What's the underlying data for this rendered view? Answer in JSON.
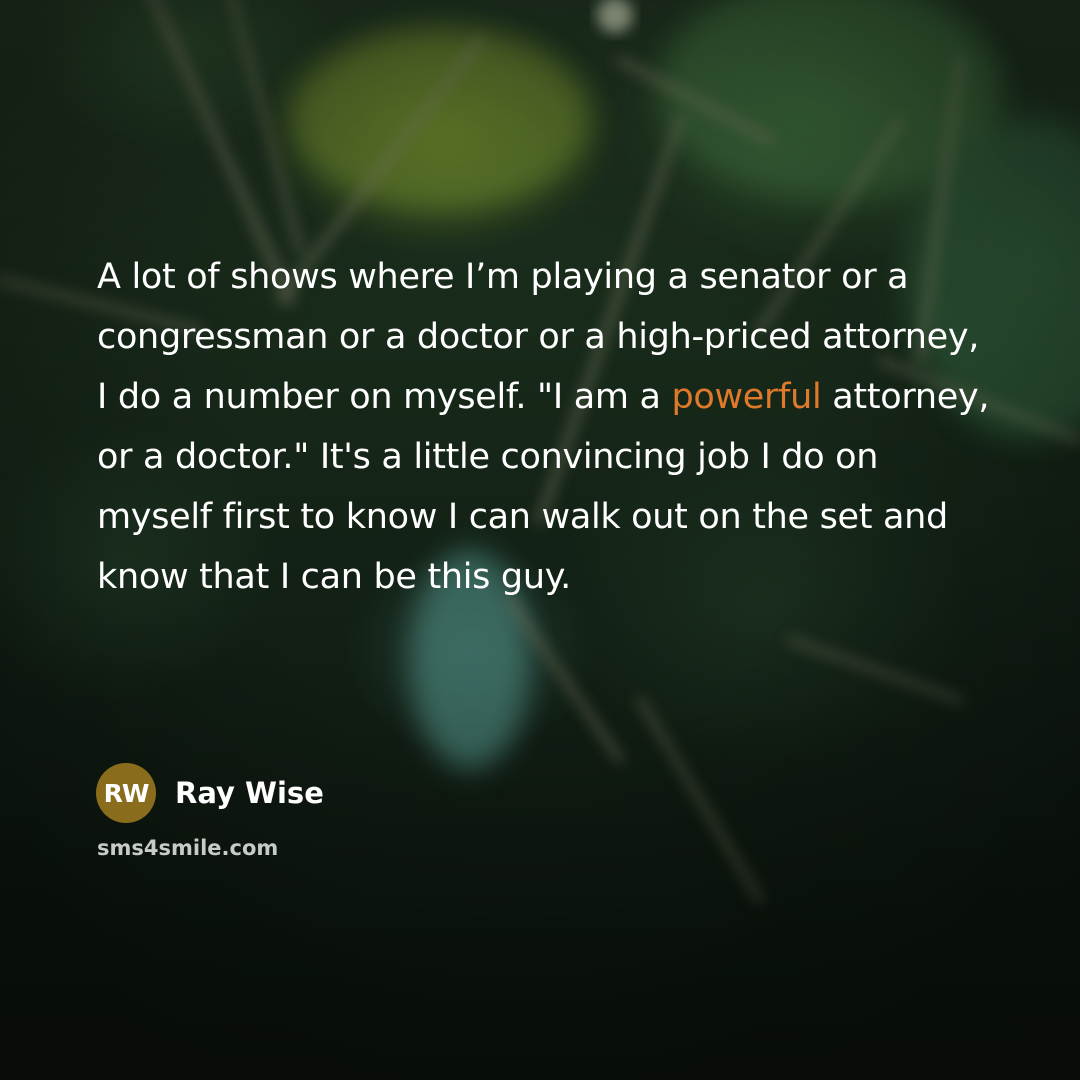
{
  "quote": {
    "before": "A lot of shows where I’m playing a senator or a congressman or a doctor or a high-priced attorney, I do a number on myself. \"I am a ",
    "highlight": "powerful",
    "after": " attorney, or a doctor.\" It's a little convincing job I do on myself first to know I can walk out on the set and know that I can be this guy."
  },
  "author": {
    "initials": "RW",
    "name": "Ray Wise"
  },
  "site": "sms4smile.com",
  "colors": {
    "highlight": "#e07a2a",
    "avatar": "#8a6d1c",
    "text": "#ffffff"
  }
}
